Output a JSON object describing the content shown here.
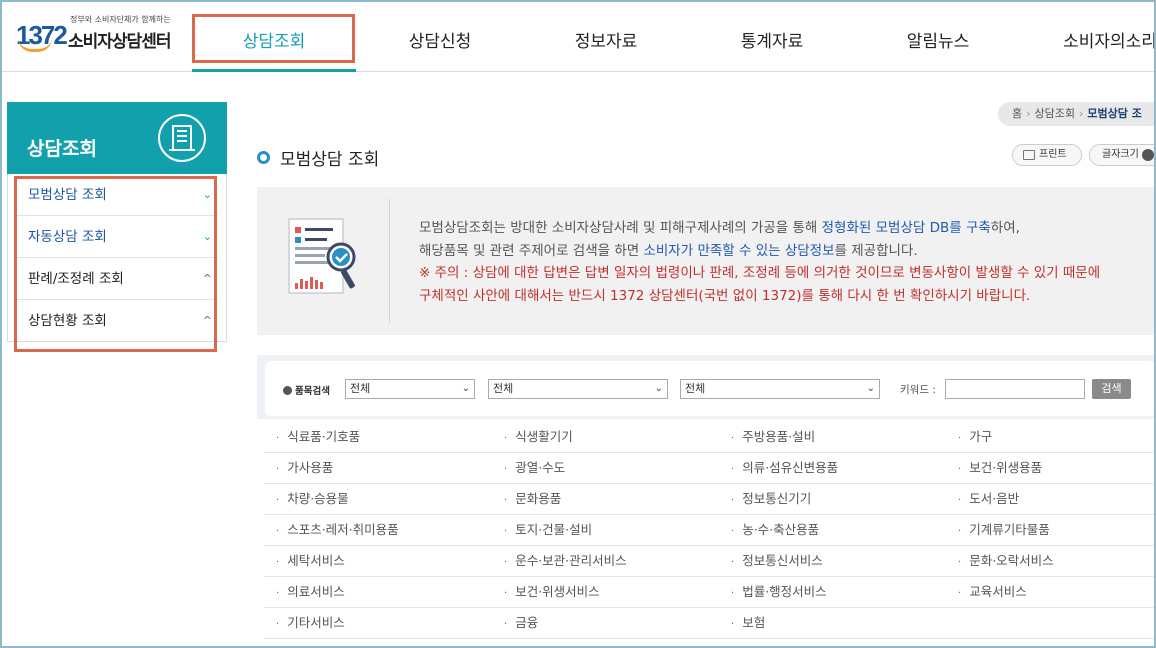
{
  "logo": {
    "number": "1372",
    "subtitle": "정부와 소비자단체가 함께하는",
    "name": "소비자상담센터"
  },
  "gnb": [
    "상담조회",
    "상담신청",
    "정보자료",
    "통계자료",
    "알림뉴스",
    "소비자의소리"
  ],
  "sidebar": {
    "title": "상담조회",
    "items": [
      {
        "label": "모범상담 조회",
        "chevron": "⌄"
      },
      {
        "label": "자동상담 조회",
        "chevron": "⌄"
      },
      {
        "label": "판례/조정례 조회",
        "chevron": "^"
      },
      {
        "label": "상담현황 조회",
        "chevron": "^"
      }
    ]
  },
  "breadcrumb": {
    "home": "홈",
    "level1": "상담조회",
    "current": "모범상담 조"
  },
  "page_title": "모범상담 조회",
  "buttons": {
    "print": "프린트",
    "font_size": "글자크기"
  },
  "info": {
    "line1_a": "모범상담조회는 방대한 소비자상담사례 및 피해구제사례의 가공을 통해 ",
    "line1_b": "정형화된 모범상담 DB를 구축",
    "line1_c": "하여,",
    "line2_a": "해당품목 및 관련 주제어로 검색을 하면 ",
    "line2_b": "소비자가 만족할 수 있는 상담정보",
    "line2_c": "를 제공합니다.",
    "line3": "※ 주의 : 상담에 대한 답변은 답변 일자의 법령이나 판례, 조정례 등에 의거한 것이므로 변동사항이 발생할 수 있기 때문에",
    "line4": "구체적인 사안에 대해서는 반드시 1372 상담센터(국번 없이 1372)를 통해 다시 한 번 확인하시기 바랍니다."
  },
  "search": {
    "label": "품목검색",
    "select1": "전체",
    "select2": "전체",
    "select3": "전체",
    "keyword_label": "키워드 :",
    "keyword_value": "",
    "button": "검색"
  },
  "categories": [
    [
      "식료품·기호품",
      "식생활기기",
      "주방용품·설비",
      "가구"
    ],
    [
      "가사용품",
      "광열·수도",
      "의류·섬유신변용품",
      "보건·위생용품"
    ],
    [
      "차량·승용물",
      "문화용품",
      "정보통신기기",
      "도서·음반"
    ],
    [
      "스포츠·레저·취미용품",
      "토지·건물·설비",
      "농·수·축산용품",
      "기계류기타물품"
    ],
    [
      "세탁서비스",
      "운수·보관·관리서비스",
      "정보통신서비스",
      "문화·오락서비스"
    ],
    [
      "의료서비스",
      "보건·위생서비스",
      "법률·행정서비스",
      "교육서비스"
    ],
    [
      "기타서비스",
      "금융",
      "보험",
      ""
    ]
  ],
  "colors": {
    "teal": "#12a0ad",
    "highlight": "#d9694a",
    "link_blue": "#1e5bb0",
    "warning_red": "#c0302b"
  }
}
